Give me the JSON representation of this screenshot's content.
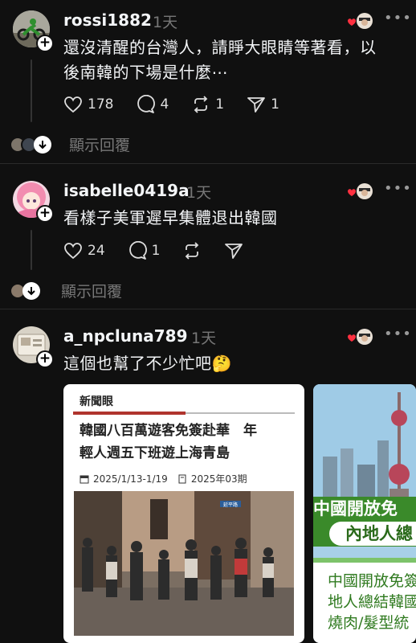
{
  "posts": [
    {
      "username": "rossi1882",
      "time": "1天",
      "text_lines": [
        "還沒清醒的台灣人，請睜大眼睛等著看，以",
        "後南韓的下場是什麼⋯"
      ],
      "likes": "178",
      "comments": "4",
      "reposts": "1",
      "shares": "1",
      "replies_label": "顯示回覆"
    },
    {
      "username": "isabelle0419a",
      "time": "1天",
      "text_lines": [
        "看樣子美軍遲早集體退出韓國"
      ],
      "likes": "24",
      "comments": "1",
      "replies_label": "顯示回覆"
    },
    {
      "username": "a_npcluna789",
      "time": "1天",
      "text_lines": [
        "這個也幫了不少忙吧🤔"
      ],
      "card1": {
        "tag": "新聞眼",
        "headline_line1": "韓國八百萬遊客免簽赴華　年",
        "headline_line2": "輕人週五下班遊上海青島",
        "date": "2025/1/13-1/19",
        "issue": "2025年03期",
        "sign_text": "延平路"
      },
      "card2": {
        "banner_line1": "中國開放免",
        "banner_line2": "內地人總",
        "text_line1": "中國開放免簽",
        "text_line2": "地人總結韓國",
        "text_line3": "燒肉/髮型統"
      }
    }
  ],
  "icons": [
    "heart-icon",
    "comment-icon",
    "repost-icon",
    "share-icon",
    "more-icon",
    "arrow-down-icon",
    "calendar-icon",
    "book-icon"
  ],
  "colors": {
    "background": "#101010",
    "muted": "#777777",
    "news_red": "#b0342d",
    "banner_green": "#3a8a2a"
  }
}
